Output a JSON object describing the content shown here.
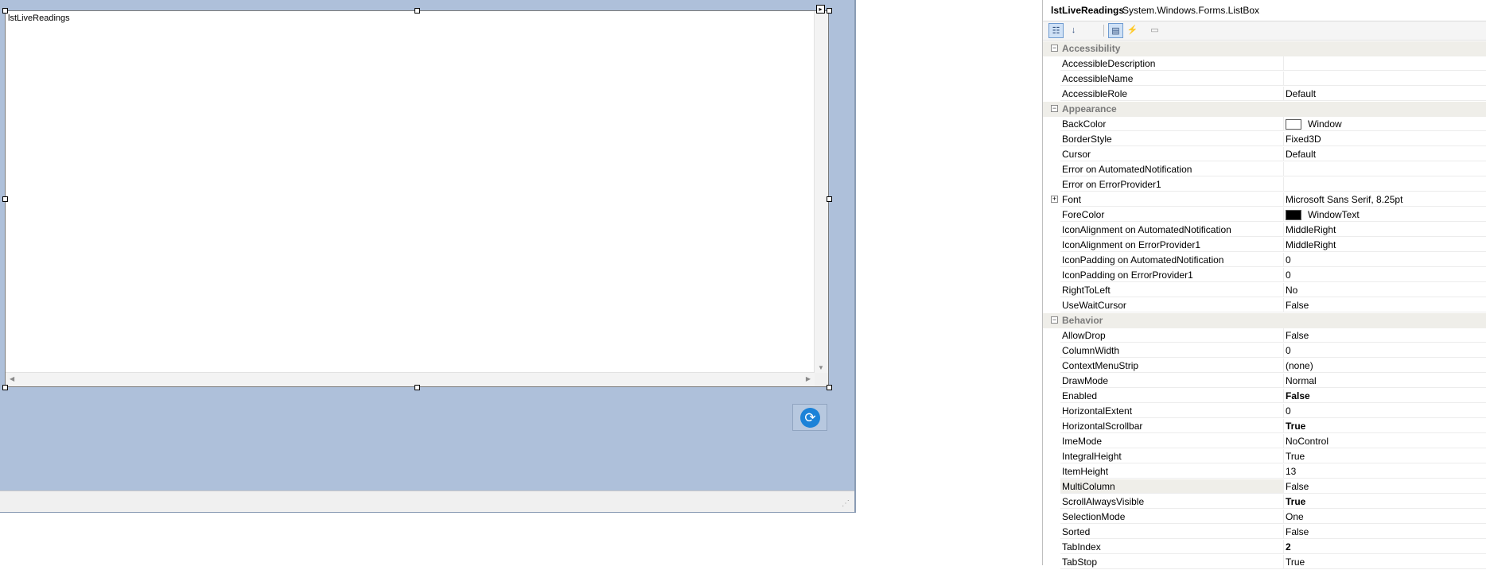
{
  "designer": {
    "listbox_name": "lstLiveReadings",
    "colors": {
      "form_background": "#aec0da",
      "listbox_background": "#ffffff",
      "refresh_icon": "#1b82d8"
    }
  },
  "properties": {
    "object_name": "lstLiveReadings",
    "object_type": "System.Windows.Forms.ListBox",
    "toolbar": [
      "categorized-icon",
      "alphabetical-icon",
      "properties-icon",
      "events-icon",
      "property-pages-icon"
    ],
    "rows": [
      {
        "kind": "category",
        "label": "Accessibility",
        "toggle": "⊟"
      },
      {
        "kind": "prop",
        "name": "AccessibleDescription",
        "value": ""
      },
      {
        "kind": "prop",
        "name": "AccessibleName",
        "value": ""
      },
      {
        "kind": "prop",
        "name": "AccessibleRole",
        "value": "Default"
      },
      {
        "kind": "category",
        "label": "Appearance",
        "toggle": "⊟"
      },
      {
        "kind": "prop",
        "name": "BackColor",
        "value": "Window",
        "swatch": "#ffffff"
      },
      {
        "kind": "prop",
        "name": "BorderStyle",
        "value": "Fixed3D"
      },
      {
        "kind": "prop",
        "name": "Cursor",
        "value": "Default"
      },
      {
        "kind": "prop",
        "name": "Error on AutomatedNotification",
        "value": ""
      },
      {
        "kind": "prop",
        "name": "Error on ErrorProvider1",
        "value": ""
      },
      {
        "kind": "prop",
        "name": "Font",
        "value": "Microsoft Sans Serif, 8.25pt",
        "expand": "+"
      },
      {
        "kind": "prop",
        "name": "ForeColor",
        "value": "WindowText",
        "swatch": "#000000"
      },
      {
        "kind": "prop",
        "name": "IconAlignment on AutomatedNotification",
        "value": "MiddleRight"
      },
      {
        "kind": "prop",
        "name": "IconAlignment on ErrorProvider1",
        "value": "MiddleRight"
      },
      {
        "kind": "prop",
        "name": "IconPadding on AutomatedNotification",
        "value": "0"
      },
      {
        "kind": "prop",
        "name": "IconPadding on ErrorProvider1",
        "value": "0"
      },
      {
        "kind": "prop",
        "name": "RightToLeft",
        "value": "No"
      },
      {
        "kind": "prop",
        "name": "UseWaitCursor",
        "value": "False"
      },
      {
        "kind": "category",
        "label": "Behavior",
        "toggle": "⊟"
      },
      {
        "kind": "prop",
        "name": "AllowDrop",
        "value": "False"
      },
      {
        "kind": "prop",
        "name": "ColumnWidth",
        "value": "0"
      },
      {
        "kind": "prop",
        "name": "ContextMenuStrip",
        "value": "(none)"
      },
      {
        "kind": "prop",
        "name": "DrawMode",
        "value": "Normal"
      },
      {
        "kind": "prop",
        "name": "Enabled",
        "value": "False",
        "bold": true
      },
      {
        "kind": "prop",
        "name": "HorizontalExtent",
        "value": "0"
      },
      {
        "kind": "prop",
        "name": "HorizontalScrollbar",
        "value": "True",
        "bold": true
      },
      {
        "kind": "prop",
        "name": "ImeMode",
        "value": "NoControl"
      },
      {
        "kind": "prop",
        "name": "IntegralHeight",
        "value": "True"
      },
      {
        "kind": "prop",
        "name": "ItemHeight",
        "value": "13"
      },
      {
        "kind": "prop",
        "name": "MultiColumn",
        "value": "False",
        "selected": true
      },
      {
        "kind": "prop",
        "name": "ScrollAlwaysVisible",
        "value": "True",
        "bold": true
      },
      {
        "kind": "prop",
        "name": "SelectionMode",
        "value": "One"
      },
      {
        "kind": "prop",
        "name": "Sorted",
        "value": "False"
      },
      {
        "kind": "prop",
        "name": "TabIndex",
        "value": "2",
        "bold": true
      },
      {
        "kind": "prop",
        "name": "TabStop",
        "value": "True"
      }
    ]
  }
}
